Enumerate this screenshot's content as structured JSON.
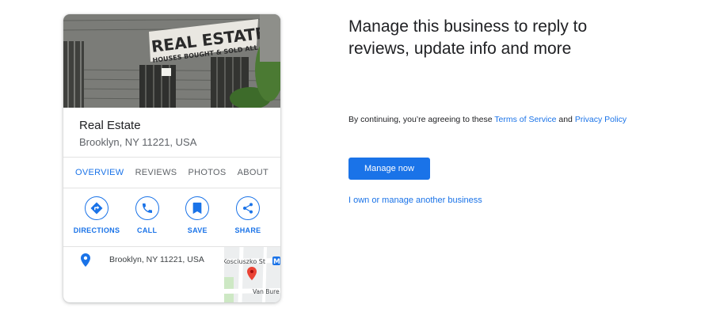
{
  "card": {
    "photo": {
      "sign_text": "REAL ESTATE",
      "sign_subtext": "HOUSES BOUGHT & SOLD ALL CASH"
    },
    "business_name": "Real Estate",
    "address": "Brooklyn, NY 11221, USA",
    "tabs": [
      {
        "label": "OVERVIEW",
        "active": true
      },
      {
        "label": "REVIEWS",
        "active": false
      },
      {
        "label": "PHOTOS",
        "active": false
      },
      {
        "label": "ABOUT",
        "active": false
      }
    ],
    "actions": [
      {
        "label": "DIRECTIONS",
        "icon": "directions-icon"
      },
      {
        "label": "CALL",
        "icon": "phone-icon"
      },
      {
        "label": "SAVE",
        "icon": "bookmark-icon"
      },
      {
        "label": "SHARE",
        "icon": "share-icon"
      }
    ],
    "location_address": "Brooklyn, NY 11221, USA",
    "map": {
      "street_1": "Kosciuszko St",
      "transit_badge": "M",
      "street_2": "Van Bure"
    }
  },
  "panel": {
    "headline": "Manage this business to reply to reviews, update info and more",
    "terms_prefix": "By continuing, you’re agreeing to these ",
    "terms_link": "Terms of Service",
    "terms_and": " and ",
    "privacy_link": "Privacy Policy",
    "manage_button": "Manage now",
    "own_link": "I own or manage another business"
  },
  "colors": {
    "accent": "#1a73e8",
    "pin_red": "#ea4335"
  }
}
